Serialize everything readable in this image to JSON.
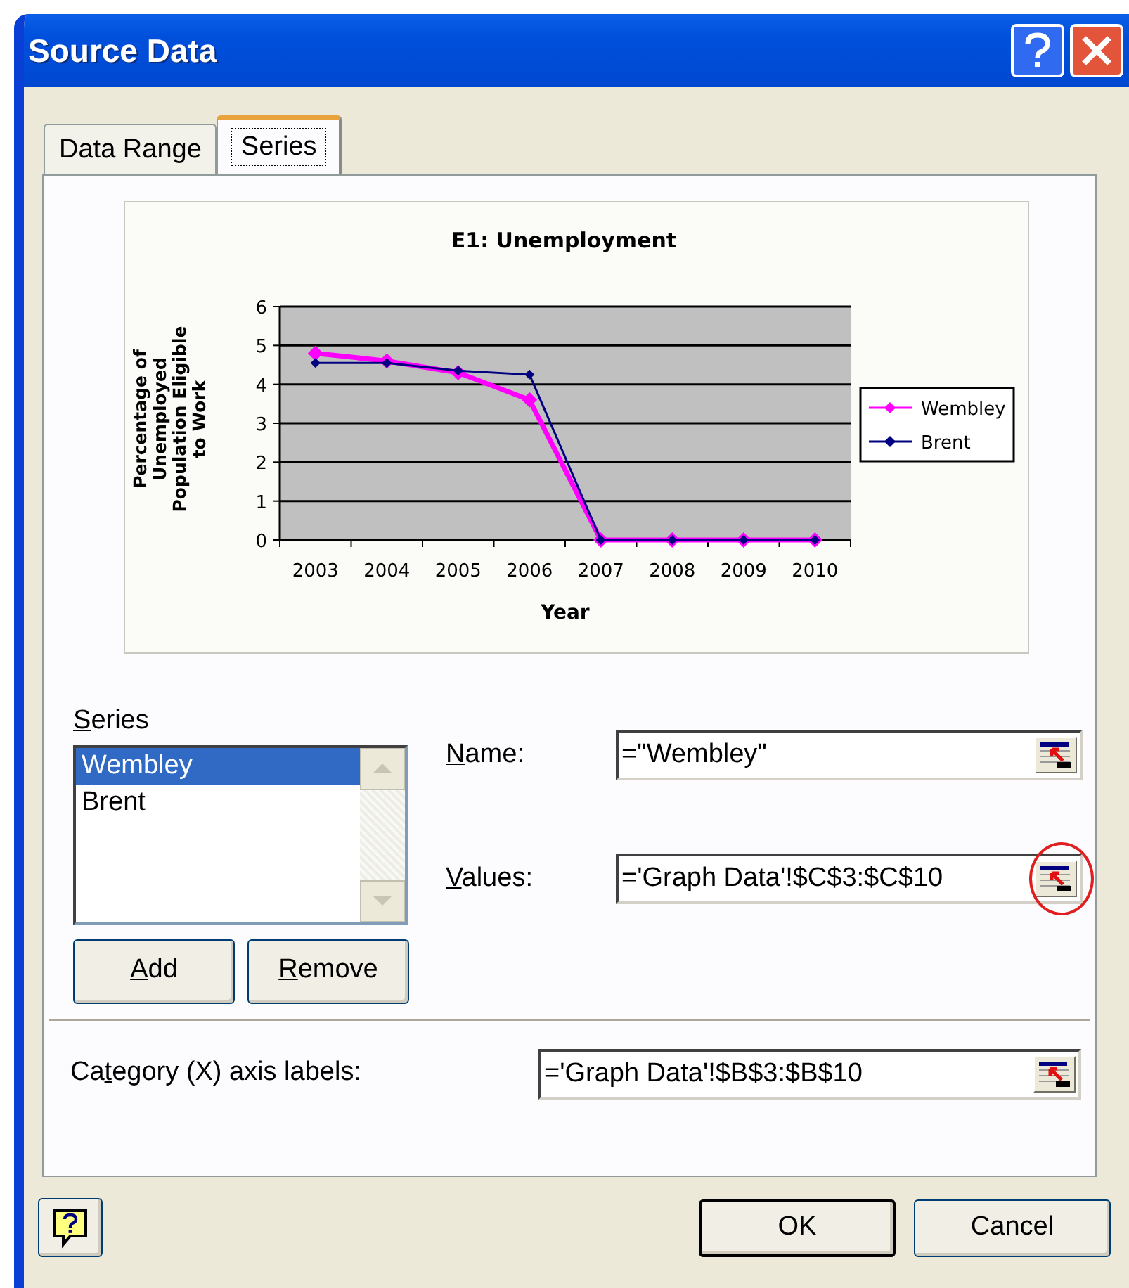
{
  "window": {
    "title": "Source Data"
  },
  "tabs": [
    {
      "label": "Data Range",
      "selected": false
    },
    {
      "label": "Series",
      "selected": true
    }
  ],
  "chart": {
    "chart_data": {
      "type": "line",
      "title": "E1: Unemployment",
      "xlabel": "Year",
      "ylabel": "Percentage of Unemployed Population Eligible to Work",
      "categories": [
        "2003",
        "2004",
        "2005",
        "2006",
        "2007",
        "2008",
        "2009",
        "2010"
      ],
      "ylim": [
        0,
        6
      ],
      "yticks": [
        0,
        1,
        2,
        3,
        4,
        5,
        6
      ],
      "grid": true,
      "legend": true,
      "series": [
        {
          "name": "Wembley",
          "color": "#ff00ff",
          "marker": "diamond",
          "values": [
            4.8,
            4.6,
            4.3,
            3.6,
            0,
            0,
            0,
            0
          ]
        },
        {
          "name": "Brent",
          "color": "#000080",
          "marker": "diamond",
          "values": [
            4.55,
            4.55,
            4.35,
            4.25,
            0,
            0,
            0,
            0
          ]
        }
      ]
    }
  },
  "series_list": {
    "label": {
      "key": "S",
      "post": "eries"
    },
    "items": [
      {
        "label": "Wembley",
        "selected": true
      },
      {
        "label": "Brent",
        "selected": false
      }
    ]
  },
  "list_buttons": [
    {
      "key": "A",
      "post": "dd"
    },
    {
      "key": "R",
      "post": "emove"
    }
  ],
  "fields": [
    {
      "label": {
        "key": "N",
        "post": "ame:"
      },
      "value": "=\"Wembley\"",
      "highlighted": false
    },
    {
      "label": {
        "key": "V",
        "post": "alues:"
      },
      "value": "='Graph Data'!$C$3:$C$10",
      "highlighted": true
    }
  ],
  "category_field": {
    "label": {
      "pre": "Ca",
      "key": "t",
      "post": "egory (X) axis labels:"
    },
    "value": "='Graph Data'!$B$3:$B$10"
  },
  "buttons": [
    {
      "label": "OK",
      "default": true
    },
    {
      "label": "Cancel",
      "default": false
    }
  ]
}
